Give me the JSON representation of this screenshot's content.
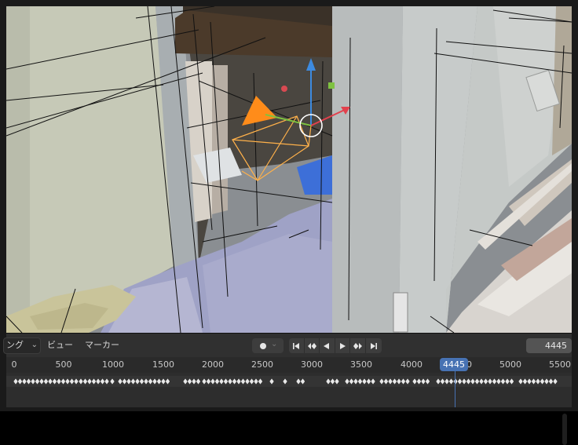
{
  "timeline_header": {
    "mode_label": "ング",
    "menu_view": "ビュー",
    "menu_marker": "マーカー",
    "current_frame_field": "4445"
  },
  "ruler": {
    "ticks": [
      "0",
      "500",
      "1000",
      "1500",
      "2000",
      "2500",
      "3000",
      "3500",
      "4000",
      "4500",
      "5000",
      "5500"
    ],
    "current_frame": "4445"
  },
  "icons": {
    "record": "record-dot-icon",
    "jump_start": "jump-to-start-icon",
    "prev_keyframe": "previous-keyframe-icon",
    "play_reverse": "play-reverse-icon",
    "play": "play-icon",
    "next_keyframe": "next-keyframe-icon",
    "jump_end": "jump-to-end-icon"
  },
  "colors": {
    "accent": "#4772b3",
    "camera_selected": "#ffb14a",
    "camera_triangle": "#ff8c1a",
    "gizmo_z": "#3d8be0",
    "gizmo_x": "#e2414d",
    "gizmo_y": "#7fc241"
  }
}
